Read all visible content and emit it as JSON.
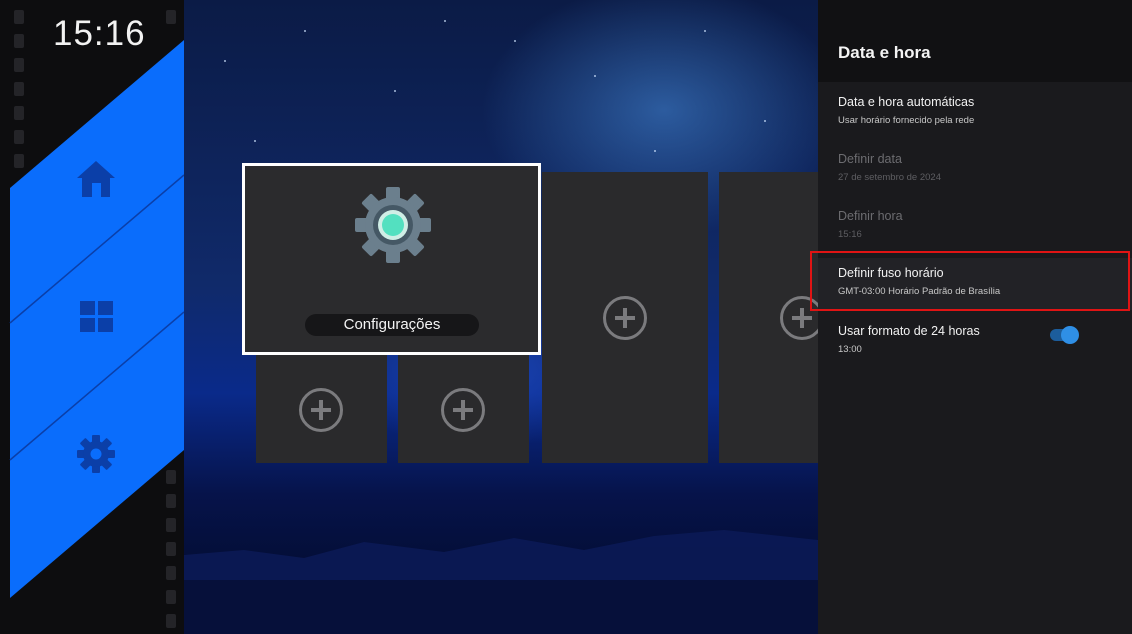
{
  "status": {
    "clock": "15:16"
  },
  "nav": {
    "items": [
      {
        "id": "home",
        "icon": "home-icon"
      },
      {
        "id": "apps",
        "icon": "grid-icon"
      },
      {
        "id": "settings",
        "icon": "gear-icon"
      }
    ],
    "accent": "#0a6dfc"
  },
  "tiles": {
    "focused_app": {
      "label": "Configurações",
      "icon": "settings-gear-icon"
    },
    "empty_slot_icon": "add-circle-icon"
  },
  "panel": {
    "title": "Data e hora",
    "options": [
      {
        "title": "Data e hora automáticas",
        "subtitle": "Usar horário fornecido pela rede",
        "state": "enabled"
      },
      {
        "title": "Definir data",
        "subtitle": "27 de setembro de 2024",
        "state": "disabled"
      },
      {
        "title": "Definir hora",
        "subtitle": "15:16",
        "state": "disabled"
      },
      {
        "title": "Definir fuso horário",
        "subtitle": "GMT-03:00 Horário Padrão de Brasília",
        "state": "highlighted"
      },
      {
        "title": "Usar formato de 24 horas",
        "subtitle": "13:00",
        "state": "enabled",
        "toggle": true
      }
    ],
    "toggle_color": "#2f8fe6",
    "highlight_border_color": "#e01414"
  }
}
